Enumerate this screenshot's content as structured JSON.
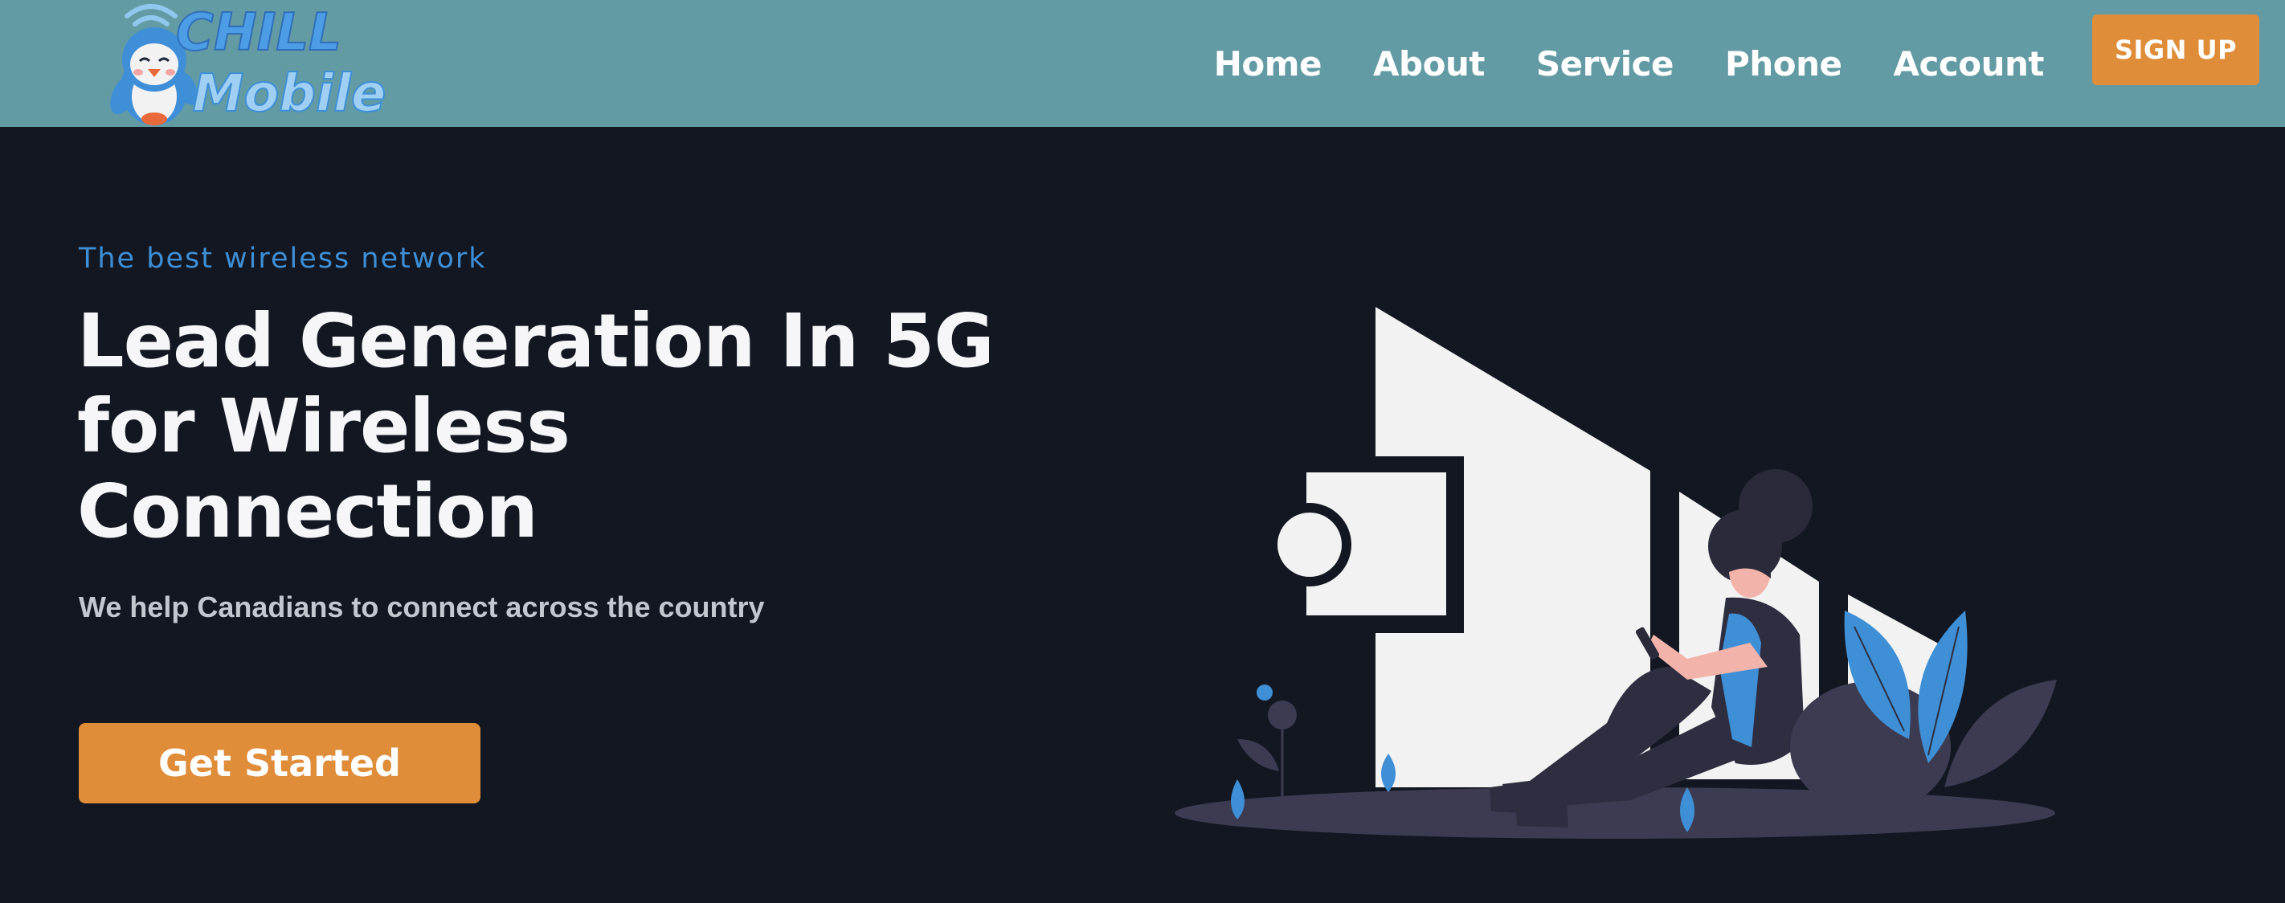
{
  "brand": {
    "line1": "CHILL",
    "line2": "Mobile"
  },
  "nav": {
    "items": [
      {
        "label": "Home"
      },
      {
        "label": "About"
      },
      {
        "label": "Service"
      },
      {
        "label": "Phone"
      },
      {
        "label": "Account"
      }
    ],
    "signup_label": "SIGN UP"
  },
  "hero": {
    "tagline": "The best wireless network",
    "title_lines": [
      "Lead Generation In 5G",
      "for Wireless",
      "Connection"
    ],
    "subtitle": "We help Canadians to connect across the country",
    "cta_label": "Get Started"
  },
  "colors": {
    "navbar_bg": "#639ba4",
    "page_bg": "#131722",
    "accent_orange": "#df8d39",
    "accent_blue": "#3e8fd6",
    "text_white": "#f6f6f8",
    "text_muted": "#c3c7cf"
  },
  "icons": {
    "logo_mascot": "penguin-wifi-icon",
    "hero_art": "woman-with-phone-illustration"
  }
}
